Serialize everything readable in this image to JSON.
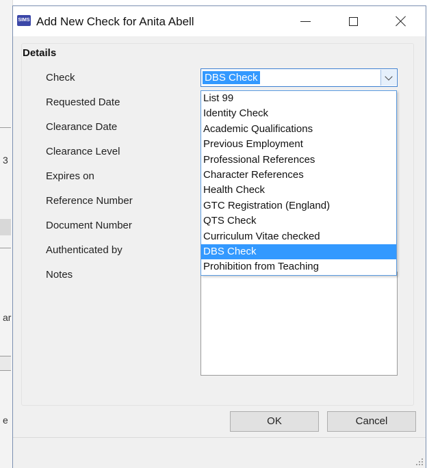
{
  "background": {
    "glyphs": [
      "3",
      "ar",
      "e"
    ]
  },
  "window": {
    "app_icon_text": "SIMS",
    "title": "Add New Check for Anita Abell",
    "minimize_icon": "minimize-icon",
    "maximize_icon": "maximize-icon",
    "close_icon": "close-icon"
  },
  "details": {
    "section_title": "Details",
    "labels": {
      "check": "Check",
      "requested_date": "Requested Date",
      "clearance_date": "Clearance Date",
      "clearance_level": "Clearance Level",
      "expires_on": "Expires on",
      "reference_number": "Reference Number",
      "document_number": "Document Number",
      "authenticated_by": "Authenticated by",
      "notes": "Notes"
    },
    "check_selected": "DBS Check",
    "check_options": [
      "List 99",
      "Identity Check",
      "Academic Qualifications",
      "Previous Employment",
      "Professional References",
      "Character References",
      "Health Check",
      "GTC Registration (England)",
      "QTS Check",
      "Curriculum Vitae checked",
      "DBS Check",
      "Prohibition from Teaching"
    ],
    "highlighted_option_index": 10
  },
  "buttons": {
    "ok": "OK",
    "cancel": "Cancel"
  },
  "colors": {
    "selection": "#3399ff",
    "combo_border": "#3c7fd1",
    "dialog_bg": "#f0f0f0"
  }
}
